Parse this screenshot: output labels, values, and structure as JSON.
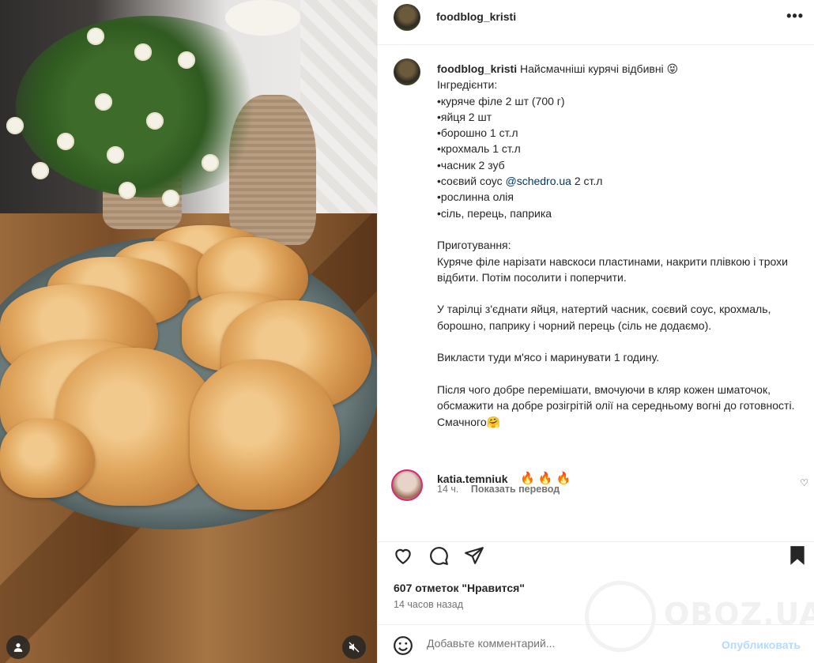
{
  "post": {
    "username": "foodblog_kristi",
    "more_icon": "more-horizontal-icon",
    "caption_title": "Найсмачніші курячі відбивні 😝",
    "caption_lines_before_mention": "\nІнгредієнти:\n•куряче філе 2 шт (700 г)\n•яйця 2 шт\n•борошно 1 ст.л\n•крохмаль 1 ст.л\n•часник 2 зуб\n•соєвий соус ",
    "mention": "@schedro.ua",
    "caption_lines_after_mention": " 2 ст.л\n•рослинна олія\n•сіль, перець, паприка\n\nПриготування:\nКуряче філе нарізати навскоси пластинами, накрити плівкою і трохи відбити. Потім посолити і поперчити.\n\nУ тарілці з'єднати яйця, натертий часник, соєвий соус, крохмаль, борошно, паприку і чорний перець (сіль не додаємо).\n\nВикласти туди м'ясо і маринувати 1 годину.\n\nПісля чого добре перемішати, вмочуючи в кляр кожен шматочок, обсмажити на добре розігрітій олії на середньому вогні до готовності.\nСмачного🤗",
    "caption_time": "14 ч.",
    "show_translation": "Показать перевод"
  },
  "comment": {
    "username": "katia.temniuk",
    "text": "🔥 🔥 🔥"
  },
  "actions": {
    "like_icon": "heart-icon",
    "comment_icon": "comment-icon",
    "share_icon": "send-icon",
    "save_icon": "bookmark-icon"
  },
  "likes": "607 отметок \"Нравится\"",
  "posted_ago": "14 часов назад",
  "add_comment": {
    "placeholder": "Добавьте комментарий...",
    "publish": "Опубликовать"
  },
  "watermark": "OBOZ.UA",
  "colors": {
    "text": "#262626",
    "secondary": "#737373",
    "link": "#00376b",
    "publish_disabled": "#b3dbff"
  }
}
